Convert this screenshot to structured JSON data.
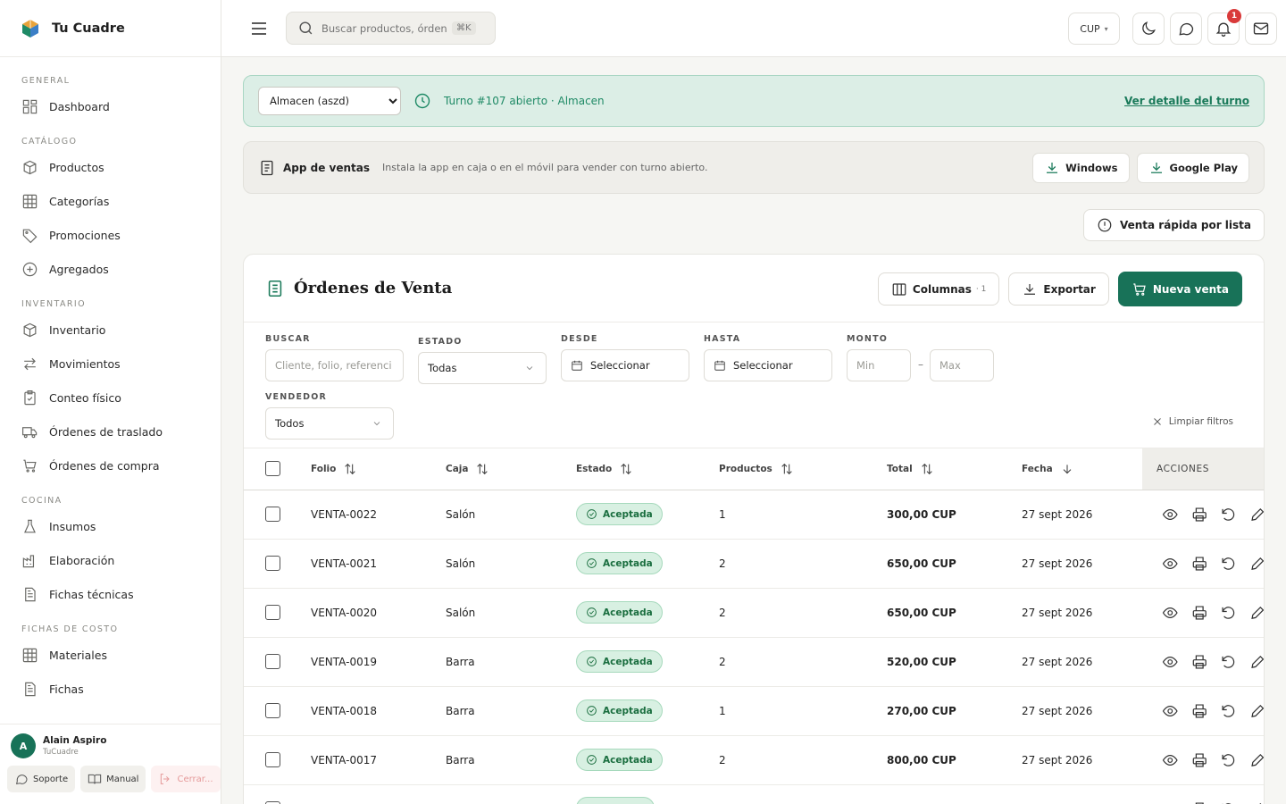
{
  "brand": {
    "name": "Tu Cuadre"
  },
  "sidebar": {
    "sections": [
      {
        "title": "GENERAL",
        "items": [
          {
            "label": "Dashboard",
            "icon": "dashboard-icon"
          }
        ]
      },
      {
        "title": "CATÁLOGO",
        "items": [
          {
            "label": "Productos",
            "icon": "box-icon"
          },
          {
            "label": "Categorías",
            "icon": "grid-icon"
          },
          {
            "label": "Promociones",
            "icon": "tag-icon"
          },
          {
            "label": "Agregados",
            "icon": "plus-circle-icon"
          }
        ]
      },
      {
        "title": "INVENTARIO",
        "items": [
          {
            "label": "Inventario",
            "icon": "box-icon"
          },
          {
            "label": "Movimientos",
            "icon": "arrows-icon"
          },
          {
            "label": "Conteo físico",
            "icon": "clipboard-check-icon"
          },
          {
            "label": "Órdenes de traslado",
            "icon": "truck-icon"
          },
          {
            "label": "Órdenes de compra",
            "icon": "cart-icon"
          }
        ]
      },
      {
        "title": "COCINA",
        "items": [
          {
            "label": "Insumos",
            "icon": "flask-icon"
          },
          {
            "label": "Elaboración",
            "icon": "factory-icon"
          },
          {
            "label": "Fichas técnicas",
            "icon": "file-icon"
          }
        ]
      },
      {
        "title": "FICHAS DE COSTO",
        "items": [
          {
            "label": "Materiales",
            "icon": "grid-icon"
          },
          {
            "label": "Fichas",
            "icon": "file-icon"
          }
        ]
      }
    ],
    "user": {
      "initial": "A",
      "name": "Alain Aspiro",
      "org": "TuCuadre"
    },
    "footer_buttons": {
      "support": "Soporte",
      "manual": "Manual",
      "logout": "Cerrar..."
    }
  },
  "topbar": {
    "search_placeholder": "Buscar productos, órdenes...",
    "shortcut": "⌘K",
    "currency": "CUP",
    "notifications_count": "1"
  },
  "turno": {
    "warehouse_selected": "Almacen (aszd)",
    "status_text": "Turno #107 abierto · Almacen",
    "link": "Ver detalle del turno"
  },
  "app_banner": {
    "title": "App de ventas",
    "description": "Instala la app en caja o en el móvil para vender con turno abierto.",
    "windows": "Windows",
    "google_play": "Google Play"
  },
  "quick_sale": "Venta rápida por lista",
  "orders": {
    "title": "Órdenes de Venta",
    "columns_btn": "Columnas",
    "columns_count": "· 1",
    "export_btn": "Exportar",
    "new_btn": "Nueva venta",
    "filters": {
      "search_label": "BUSCAR",
      "search_placeholder": "Cliente, folio, referencia...",
      "status_label": "ESTADO",
      "status_value": "Todas",
      "from_label": "DESDE",
      "from_value": "Seleccionar",
      "to_label": "HASTA",
      "to_value": "Seleccionar",
      "amount_label": "MONTO",
      "min_placeholder": "Min",
      "max_placeholder": "Max",
      "seller_label": "VENDEDOR",
      "seller_value": "Todos",
      "clear": "Limpiar filtros"
    },
    "columns": {
      "folio": "Folio",
      "caja": "Caja",
      "estado": "Estado",
      "productos": "Productos",
      "total": "Total",
      "fecha": "Fecha",
      "acciones": "ACCIONES"
    },
    "rows": [
      {
        "folio": "VENTA-0022",
        "caja": "Salón",
        "estado": "Aceptada",
        "productos": "1",
        "total": "300,00 CUP",
        "fecha": "27 sept 2026"
      },
      {
        "folio": "VENTA-0021",
        "caja": "Salón",
        "estado": "Aceptada",
        "productos": "2",
        "total": "650,00 CUP",
        "fecha": "27 sept 2026"
      },
      {
        "folio": "VENTA-0020",
        "caja": "Salón",
        "estado": "Aceptada",
        "productos": "2",
        "total": "650,00 CUP",
        "fecha": "27 sept 2026"
      },
      {
        "folio": "VENTA-0019",
        "caja": "Barra",
        "estado": "Aceptada",
        "productos": "2",
        "total": "520,00 CUP",
        "fecha": "27 sept 2026"
      },
      {
        "folio": "VENTA-0018",
        "caja": "Barra",
        "estado": "Aceptada",
        "productos": "1",
        "total": "270,00 CUP",
        "fecha": "27 sept 2026"
      },
      {
        "folio": "VENTA-0017",
        "caja": "Barra",
        "estado": "Aceptada",
        "productos": "2",
        "total": "800,00 CUP",
        "fecha": "27 sept 2026"
      },
      {
        "folio": "",
        "caja": "",
        "estado": "",
        "productos": "",
        "total": "",
        "fecha": ""
      }
    ]
  },
  "colors": {
    "primary": "#187258",
    "accent_text": "#1f8a66",
    "turno_bg": "#dceee6",
    "badge": "#d93a3a",
    "status_bg": "#d8f0e2"
  }
}
